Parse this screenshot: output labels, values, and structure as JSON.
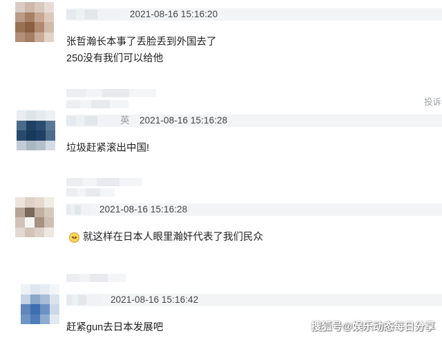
{
  "comments": [
    {
      "timestamp": "2021-08-16 15:16:20",
      "lines": [
        "张哲瀚长本事了丢脸丢到外国去了",
        "250没有我们可以给他"
      ]
    },
    {
      "timestamp": "2021-08-16 15:16:28",
      "name_fragment": "英",
      "lines": [
        "垃圾赶紧滚出中国!"
      ]
    },
    {
      "timestamp": "2021-08-16 15:16:28",
      "emoji": "sad-face-emoji",
      "lines": [
        "就这样在日本人眼里瀚奸代表了我们民众"
      ]
    },
    {
      "timestamp": "2021-08-16 15:16:42",
      "lines": [
        "赶紧gun去日本发展吧"
      ]
    }
  ],
  "report_label": "投诉",
  "watermark": "搜狐号@娱乐动态每日分享",
  "colors": {
    "meta_bar": "#f2f4f6",
    "timestamp": "#444444",
    "comment_text": "#1f1f1f",
    "report": "#9aa0a6"
  }
}
